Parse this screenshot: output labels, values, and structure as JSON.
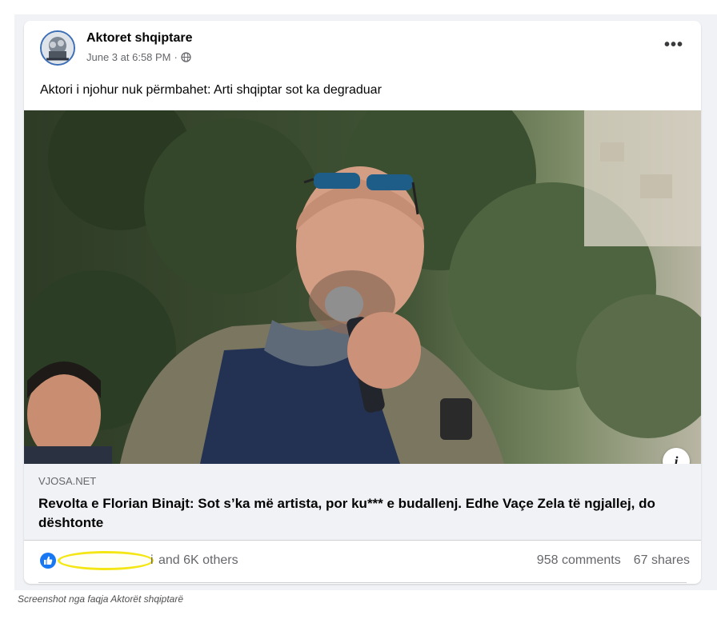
{
  "post": {
    "page_name": "Aktoret shqiptare",
    "timestamp": "June 3 at 6:58 PM",
    "separator": " · ",
    "privacy_icon": "globe-icon",
    "more_label": "•••",
    "text": "Aktori i njohur nuk përmbahet: Arti shqiptar sot ka degraduar"
  },
  "link": {
    "domain": "VJOSA.NET",
    "title": "Revolta e Florian Binajt: Sot s’ka më artista, por ku*** e budallenj. Edhe Vaçe Zela të ngjallej, do dështonte",
    "info_label": "i"
  },
  "reactions": {
    "reaction_icon": "like-icon",
    "names_fragment": "i",
    "others_text": "and 6K others",
    "comments_text": "958 comments",
    "shares_text": "67 shares"
  },
  "caption": "Screenshot nga faqja Aktorët shqiptarë",
  "colors": {
    "facebook_blue": "#1877f2",
    "highlight_yellow": "#f4e613",
    "link_box_bg": "#f0f2f5"
  }
}
